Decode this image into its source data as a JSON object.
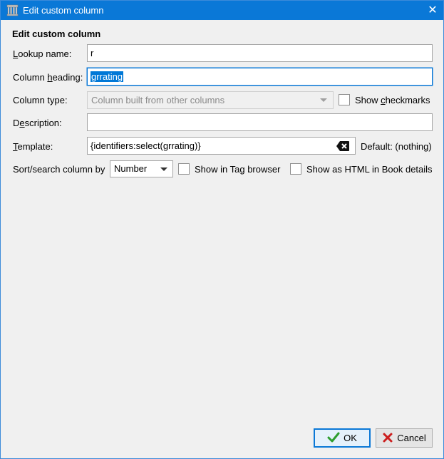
{
  "window": {
    "title": "Edit custom column",
    "close_glyph": "✕",
    "icon": "library-icon"
  },
  "heading": "Edit custom column",
  "lookup": {
    "label_u": "L",
    "label_rest": "ookup name:",
    "value": "r"
  },
  "heading_field": {
    "label_pre": "Column ",
    "label_u": "h",
    "label_rest": "eading:",
    "value": "grrating"
  },
  "type": {
    "label": "Column type:",
    "value": "Column built from other columns",
    "checkbox_pre": "Show ",
    "checkbox_u": "c",
    "checkbox_rest": "heckmarks"
  },
  "description": {
    "label_pre": "D",
    "label_u": "e",
    "label_rest": "scription:",
    "value": ""
  },
  "template": {
    "label_u": "T",
    "label_rest": "emplate:",
    "value": "{identifiers:select(grrating)}",
    "default_text": "Default: (nothing)"
  },
  "sort": {
    "label": "Sort/search column by",
    "value": "Number",
    "tag_browser_label": "Show in Tag browser",
    "html_label": "Show as HTML in Book details"
  },
  "buttons": {
    "ok": "OK",
    "cancel": "Cancel"
  },
  "colors": {
    "titlebar": "#0a78d7",
    "ok_check": "#2e9e2e",
    "cancel_x": "#cc1f1f"
  }
}
